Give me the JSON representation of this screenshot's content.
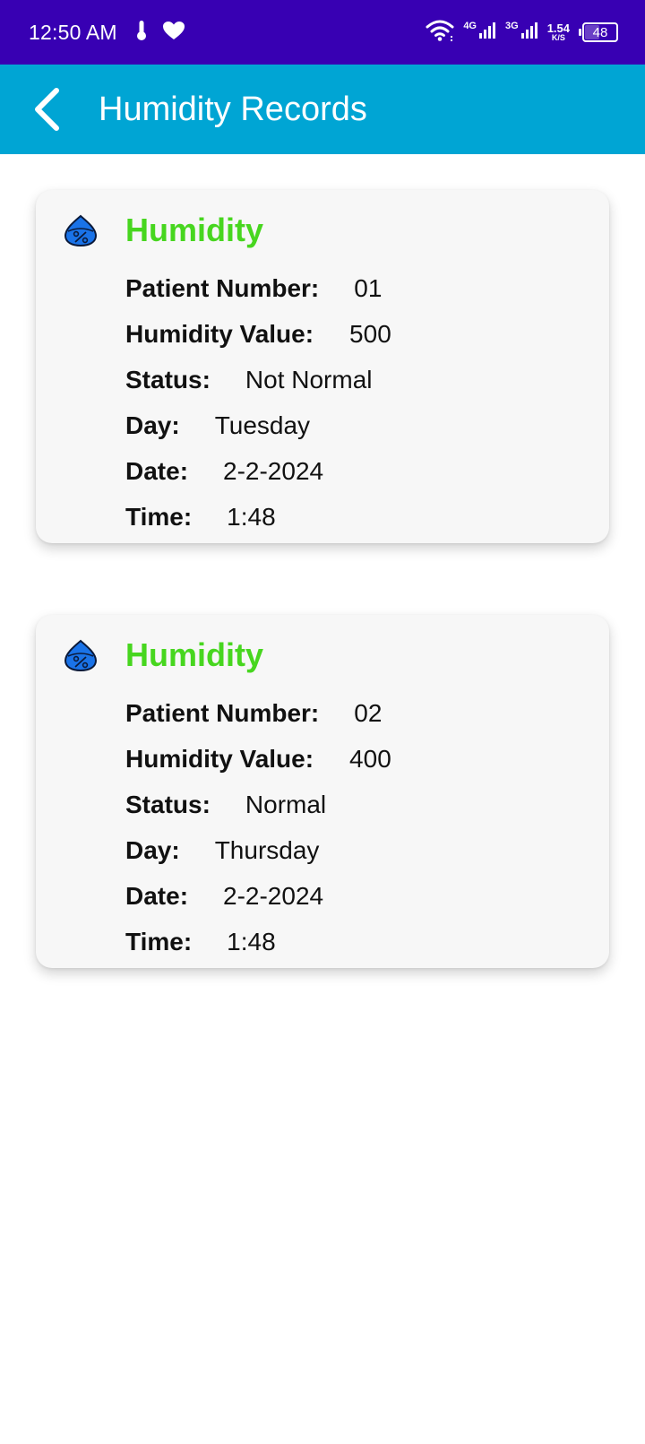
{
  "status_bar": {
    "time": "12:50 AM",
    "net_4g": "4G",
    "net_3g": "3G",
    "speed_value": "1.54",
    "speed_unit": "K/S",
    "battery": "48"
  },
  "app_bar": {
    "title": "Humidity Records"
  },
  "colors": {
    "status_bar": "#3800b3",
    "app_bar": "#00a5d4",
    "card_title": "#47d61f"
  },
  "records": [
    {
      "title": "Humidity",
      "patient_label": "Patient Number:",
      "patient": "01",
      "value_label": "Humidity Value:",
      "value": "500",
      "status_label": "Status:",
      "status": "Not Normal",
      "day_label": "Day:",
      "day": "Tuesday",
      "date_label": "Date:",
      "date": "2-2-2024",
      "time_label": "Time:",
      "time": "1:48"
    },
    {
      "title": "Humidity",
      "patient_label": "Patient Number:",
      "patient": "02",
      "value_label": "Humidity Value:",
      "value": "400",
      "status_label": "Status:",
      "status": "Normal",
      "day_label": "Day:",
      "day": "Thursday",
      "date_label": "Date:",
      "date": "2-2-2024",
      "time_label": "Time:",
      "time": "1:48"
    }
  ]
}
